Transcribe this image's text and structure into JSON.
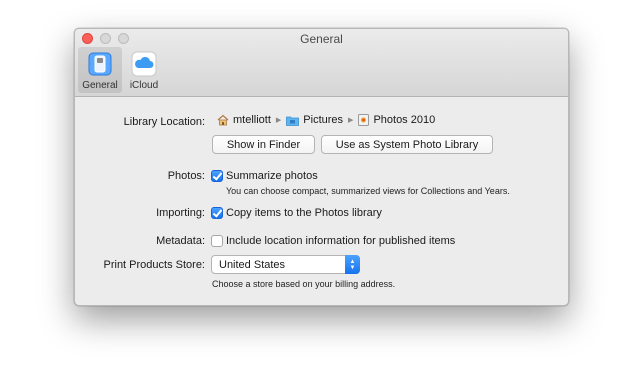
{
  "window": {
    "title": "General"
  },
  "toolbar": {
    "items": [
      {
        "label": "General",
        "icon": "general-switch-icon",
        "selected": true
      },
      {
        "label": "iCloud",
        "icon": "icloud-icon",
        "selected": false
      }
    ]
  },
  "library": {
    "label": "Library Location:",
    "path": [
      {
        "name": "mtelliott",
        "icon": "home-icon"
      },
      {
        "name": "Pictures",
        "icon": "folder-icon"
      },
      {
        "name": "Photos 2010",
        "icon": "photos-library-icon"
      }
    ],
    "show_in_finder": "Show in Finder",
    "use_as_system": "Use as System Photo Library"
  },
  "photos": {
    "label": "Photos:",
    "checkbox_label": "Summarize photos",
    "checked": true,
    "help": "You can choose compact, summarized views for Collections and Years."
  },
  "importing": {
    "label": "Importing:",
    "checkbox_label": "Copy items to the Photos library",
    "checked": true
  },
  "metadata": {
    "label": "Metadata:",
    "checkbox_label": "Include location information for published items",
    "checked": false
  },
  "store": {
    "label": "Print Products Store:",
    "selected": "United States",
    "help": "Choose a store based on your billing address."
  },
  "colors": {
    "accent": "#1673ee",
    "close": "#fc5f57"
  }
}
